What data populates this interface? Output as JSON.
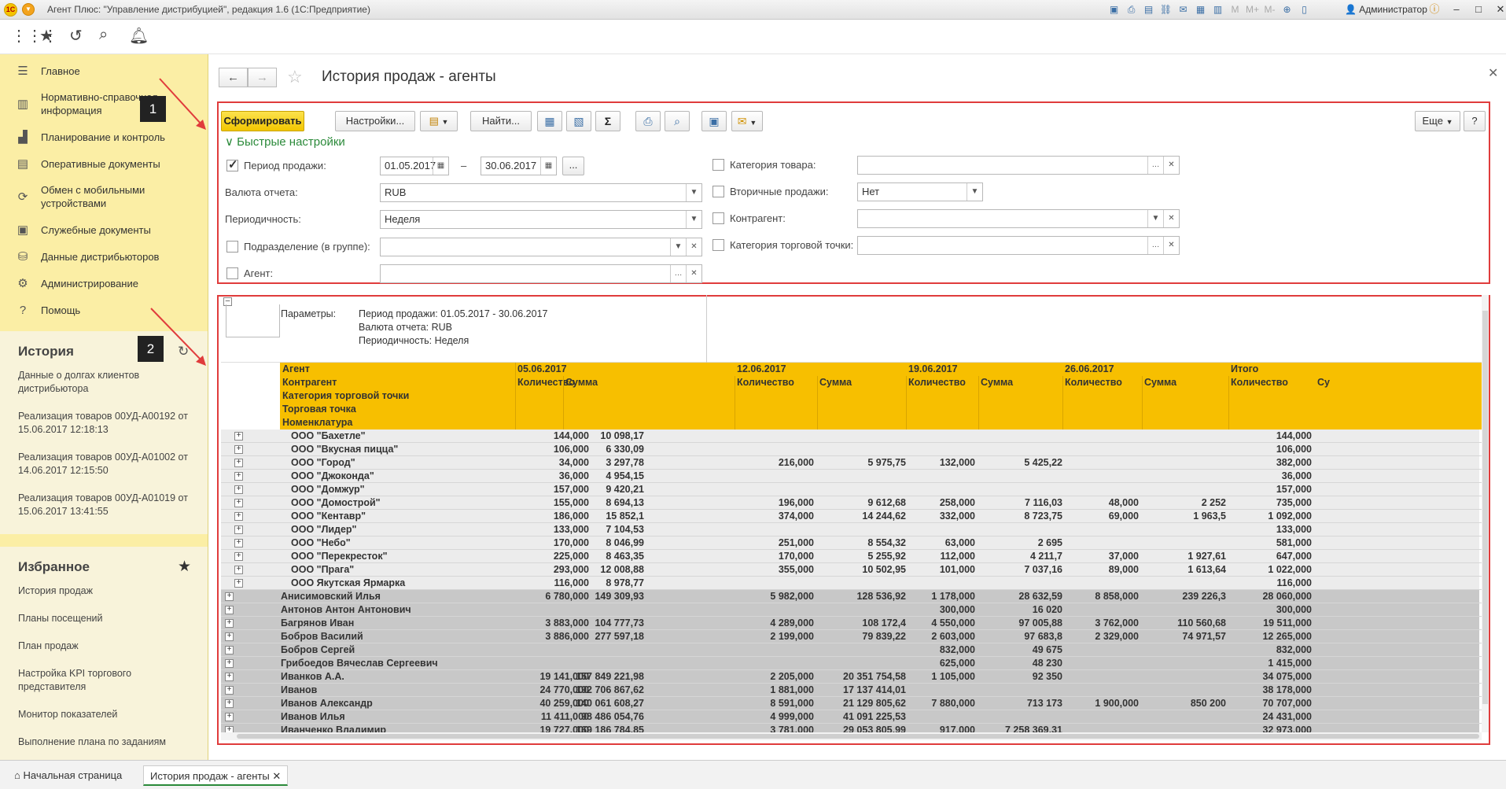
{
  "window": {
    "title": "Агент Плюс: \"Управление дистрибуцией\", редакция 1.6 (1С:Предприятие)",
    "user": "Администратор",
    "tb_labels": {
      "m": "M",
      "mplus": "M+",
      "mminus": "M-"
    }
  },
  "sidebar": {
    "nav": [
      {
        "label": "Главное",
        "icon": "menu-lines-icon"
      },
      {
        "label": "Нормативно-справочная информация",
        "icon": "grid-book-icon"
      },
      {
        "label": "Планирование и контроль",
        "icon": "bar-chart-icon"
      },
      {
        "label": "Оперативные документы",
        "icon": "document-icon"
      },
      {
        "label": "Обмен с мобильными устройствами",
        "icon": "sync-icon"
      },
      {
        "label": "Служебные документы",
        "icon": "documents-icon"
      },
      {
        "label": "Данные дистрибьюторов",
        "icon": "network-icon"
      },
      {
        "label": "Администрирование",
        "icon": "gear-icon"
      },
      {
        "label": "Помощь",
        "icon": "help-icon"
      }
    ],
    "history_title": "История",
    "history": [
      "Данные о долгах клиентов дистрибьютора",
      "Реализация товаров 00УД-А00192 от 15.06.2017 12:18:13",
      "Реализация товаров 00УД-А01002 от 14.06.2017 12:15:50",
      "Реализация товаров 00УД-А01019 от 15.06.2017 13:41:55"
    ],
    "fav_title": "Избранное",
    "favorites": [
      "История продаж",
      "Планы посещений",
      "План продаж",
      "Настройка KPI торгового представителя",
      "Монитор показателей",
      "Выполнение плана по заданиям"
    ]
  },
  "badges": {
    "one": "1",
    "two": "2"
  },
  "header": {
    "title": "История продаж - агенты"
  },
  "toolbar": {
    "generate": "Сформировать",
    "settings": "Настройки...",
    "find": "Найти...",
    "more": "Еще",
    "help": "?"
  },
  "quick": {
    "title": "Быстрые настройки",
    "period_label": "Период продажи:",
    "date_from": "01.05.2017",
    "dash": "–",
    "date_to": "30.06.2017",
    "currency_label": "Валюта отчета:",
    "currency": "RUB",
    "period_type_label": "Периодичность:",
    "period_type": "Неделя",
    "division_label": "Подразделение (в группе):",
    "agent_label": "Агент:",
    "cat_label": "Категория товара:",
    "secondary_label": "Вторичные продажи:",
    "secondary": "Нет",
    "counterparty_label": "Контрагент:",
    "point_cat_label": "Категория торговой точки:"
  },
  "report": {
    "params_label": "Параметры:",
    "params": [
      "Период продажи: 01.05.2017 - 30.06.2017",
      "Валюта отчета: RUB",
      "Периодичность: Неделя"
    ],
    "dims": [
      "Агент",
      "Контрагент",
      "Категория торговой точки",
      "Торговая точка",
      "Номенклатура"
    ],
    "weeks": [
      "05.06.2017",
      "12.06.2017",
      "19.06.2017",
      "26.06.2017",
      "Итого"
    ],
    "qty": "Количество",
    "sum": "Сумма",
    "sum_cut": "Су",
    "sub_rows": [
      {
        "name": "ООО \"Бахетле\"",
        "v": [
          "144,000",
          "10 098,17",
          "",
          "",
          "",
          "",
          "",
          "",
          "144,000"
        ]
      },
      {
        "name": "ООО \"Вкусная пицца\"",
        "v": [
          "106,000",
          "6 330,09",
          "",
          "",
          "",
          "",
          "",
          "",
          "106,000"
        ]
      },
      {
        "name": "ООО \"Город\"",
        "v": [
          "34,000",
          "3 297,78",
          "216,000",
          "5 975,75",
          "132,000",
          "5 425,22",
          "",
          "",
          "382,000"
        ]
      },
      {
        "name": "ООО \"Джоконда\"",
        "v": [
          "36,000",
          "4 954,15",
          "",
          "",
          "",
          "",
          "",
          "",
          "36,000"
        ]
      },
      {
        "name": "ООО \"Домжур\"",
        "v": [
          "157,000",
          "9 420,21",
          "",
          "",
          "",
          "",
          "",
          "",
          "157,000"
        ]
      },
      {
        "name": "ООО \"Домострой\"",
        "v": [
          "155,000",
          "8 694,13",
          "196,000",
          "9 612,68",
          "258,000",
          "7 116,03",
          "48,000",
          "2 252",
          "735,000"
        ]
      },
      {
        "name": "ООО \"Кентавр\"",
        "v": [
          "186,000",
          "15 852,1",
          "374,000",
          "14 244,62",
          "332,000",
          "8 723,75",
          "69,000",
          "1 963,5",
          "1 092,000"
        ]
      },
      {
        "name": "ООО \"Лидер\"",
        "v": [
          "133,000",
          "7 104,53",
          "",
          "",
          "",
          "",
          "",
          "",
          "133,000"
        ]
      },
      {
        "name": "ООО \"Небо\"",
        "v": [
          "170,000",
          "8 046,99",
          "251,000",
          "8 554,32",
          "63,000",
          "2 695",
          "",
          "",
          "581,000"
        ]
      },
      {
        "name": "ООО \"Перекресток\"",
        "v": [
          "225,000",
          "8 463,35",
          "170,000",
          "5 255,92",
          "112,000",
          "4 211,7",
          "37,000",
          "1 927,61",
          "647,000"
        ]
      },
      {
        "name": "ООО \"Прага\"",
        "v": [
          "293,000",
          "12 008,88",
          "355,000",
          "10 502,95",
          "101,000",
          "7 037,16",
          "89,000",
          "1 613,64",
          "1 022,000"
        ]
      },
      {
        "name": "ООО Якутская Ярмарка",
        "v": [
          "116,000",
          "8 978,77",
          "",
          "",
          "",
          "",
          "",
          "",
          "116,000"
        ]
      }
    ],
    "agent_rows": [
      {
        "name": "Анисимовский Илья",
        "v": [
          "6 780,000",
          "149 309,93",
          "5 982,000",
          "128 536,92",
          "1 178,000",
          "28 632,59",
          "8 858,000",
          "239 226,3",
          "28 060,000"
        ]
      },
      {
        "name": "Антонов Антон Антонович",
        "v": [
          "",
          "",
          "",
          "",
          "300,000",
          "16 020",
          "",
          "",
          "300,000"
        ]
      },
      {
        "name": "Багрянов Иван",
        "v": [
          "3 883,000",
          "104 777,73",
          "4 289,000",
          "108 172,4",
          "4 550,000",
          "97 005,88",
          "3 762,000",
          "110 560,68",
          "19 511,000"
        ]
      },
      {
        "name": "Бобров Василий",
        "v": [
          "3 886,000",
          "277 597,18",
          "2 199,000",
          "79 839,22",
          "2 603,000",
          "97 683,8",
          "2 329,000",
          "74 971,57",
          "12 265,000"
        ]
      },
      {
        "name": "Бобров Сергей",
        "v": [
          "",
          "",
          "",
          "",
          "832,000",
          "49 675",
          "",
          "",
          "832,000"
        ]
      },
      {
        "name": "Грибоедов Вячеслав Сергеевич",
        "v": [
          "",
          "",
          "",
          "",
          "625,000",
          "48 230",
          "",
          "",
          "1 415,000"
        ]
      },
      {
        "name": "Иванков А.А.",
        "v": [
          "19 141,000",
          "157 849 221,98",
          "2 205,000",
          "20 351 754,58",
          "1 105,000",
          "92 350",
          "",
          "",
          "34 075,000"
        ]
      },
      {
        "name": "Иванов",
        "v": [
          "24 770,000",
          "192 706 867,62",
          "1 881,000",
          "17 137 414,01",
          "",
          "",
          "",
          "",
          "38 178,000"
        ]
      },
      {
        "name": "Иванов Александр",
        "v": [
          "40 259,000",
          "140 061 608,27",
          "8 591,000",
          "21 129 805,62",
          "7 880,000",
          "713 173",
          "1 900,000",
          "850 200",
          "70 707,000"
        ]
      },
      {
        "name": "Иванов Илья",
        "v": [
          "11 411,000",
          "98 486 054,76",
          "4 999,000",
          "41 091 225,53",
          "",
          "",
          "",
          "",
          "24 431,000"
        ]
      },
      {
        "name": "Иванченко Владимир",
        "v": [
          "19 727,000",
          "169 186 784,85",
          "3 781,000",
          "29 053 805,99",
          "917,000",
          "7 258 369,31",
          "",
          "",
          "32 973,000"
        ]
      }
    ]
  },
  "tabs": {
    "home": "Начальная страница",
    "current": "История продаж - агенты"
  }
}
